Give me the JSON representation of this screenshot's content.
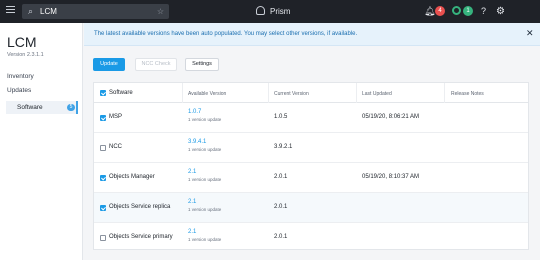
{
  "topbar": {
    "search_value": "LCM",
    "brand": "Prism",
    "alerts_count": "4",
    "tasks_count": "1",
    "help_label": "?",
    "icons": [
      "menu-icon",
      "search-icon",
      "star-icon",
      "prism-logo-icon",
      "bell-icon",
      "status-ring-icon",
      "help-icon",
      "gear-icon"
    ]
  },
  "sidebar": {
    "app_title": "LCM",
    "version": "Version 2.3.1.1",
    "links": [
      {
        "label": "Inventory"
      },
      {
        "label": "Updates"
      }
    ],
    "selected": {
      "label": "Software",
      "count": "5"
    }
  },
  "banner": {
    "message": "The latest available versions have been auto populated. You may select other versions, if available.",
    "close_label": "✕"
  },
  "actions": {
    "update_label": "Update",
    "ncc_label": "NCC Check",
    "settings_label": "Settings"
  },
  "table": {
    "headers": {
      "software": "Software",
      "available": "Available Version",
      "current": "Current Version",
      "last_updated": "Last Updated",
      "release_notes": "Release Notes"
    },
    "rows": [
      {
        "name": "MSP",
        "checked": true,
        "available": "1.0.7",
        "sub": "1 version update",
        "current": "1.0.5",
        "last_updated": "05/19/20, 8:06:21 AM"
      },
      {
        "name": "NCC",
        "checked": false,
        "available": "3.9.4.1",
        "sub": "1 version update",
        "current": "3.9.2.1",
        "last_updated": ""
      },
      {
        "name": "Objects Manager",
        "checked": true,
        "available": "2.1",
        "sub": "1 version update",
        "current": "2.0.1",
        "last_updated": "05/19/20, 8:10:37 AM"
      },
      {
        "name": "Objects Service replica",
        "checked": true,
        "available": "2.1",
        "sub": "1 version update",
        "current": "2.0.1",
        "last_updated": ""
      },
      {
        "name": "Objects Service primary",
        "checked": false,
        "available": "2.1",
        "sub": "1 version update",
        "current": "2.0.1",
        "last_updated": ""
      }
    ]
  },
  "colors": {
    "accent": "#1a9ae6",
    "topbar": "#1f2228",
    "alert_red": "#e8504f",
    "ok_green": "#36b37e",
    "banner_bg": "#e6f2fb"
  }
}
